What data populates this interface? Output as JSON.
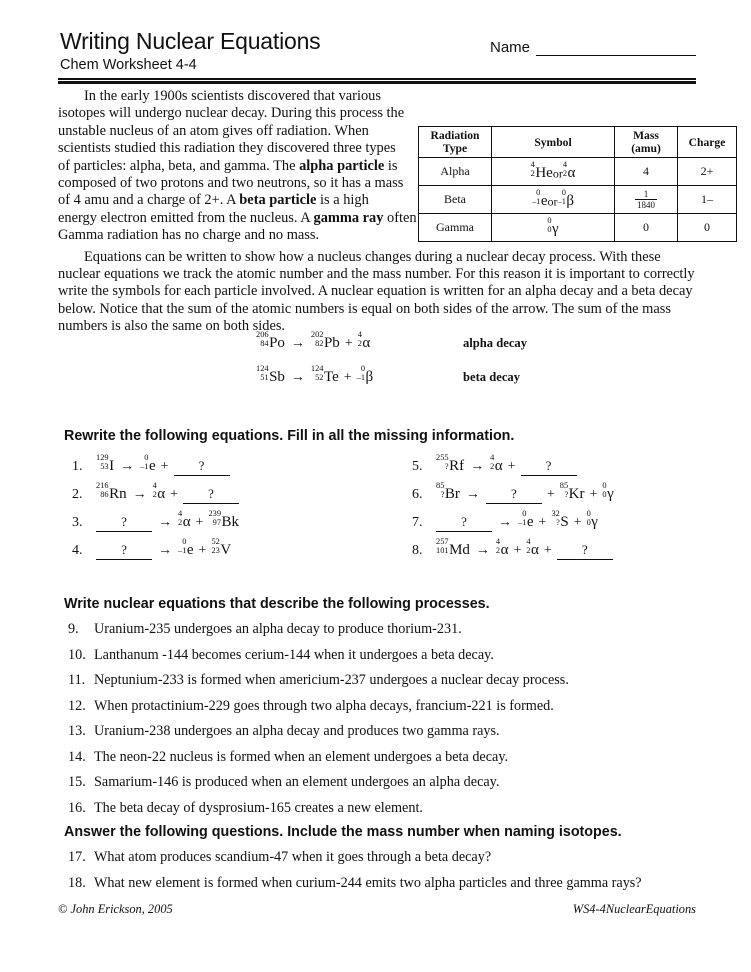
{
  "header": {
    "title": "Writing Nuclear Equations",
    "subtitle": "Chem Worksheet 4-4",
    "name_label": "Name"
  },
  "intro": {
    "p1_part1": "In the early 1900s scientists discovered that various isotopes will undergo nuclear decay. During this process the unstable nucleus of an atom gives off radiation. When scientists studied this radiation they discovered three types of particles: alpha, beta, and gamma. The ",
    "p1_b1": "alpha particle",
    "p1_part2": " is composed of two protons and two neutrons, so it has a mass of 4 amu and a charge of 2+. A ",
    "p1_b2": "beta particle",
    "p1_part3": " is a high energy electron emitted from the nucleus. A ",
    "p1_b3": "gamma ray",
    "p1_part4": " often accompanies the other decay processes. Gamma radiation has no charge and no mass.",
    "p2": "Equations can be written to show how a nucleus changes during a nuclear decay process. With these nuclear equations we track the atomic number and the mass number. For this reason it is important to correctly write the symbols for each particle involved. A nuclear equation is written for an alpha decay and a beta decay below. Notice that the sum of the atomic numbers is equal on both sides of the arrow. The sum of the mass numbers is also the same on both sides."
  },
  "radiation_table": {
    "headers": [
      "Radiation Type",
      "Symbol",
      "Mass (amu)",
      "Charge"
    ],
    "header_lines": {
      "type_l1": "Radiation",
      "type_l2": "Type",
      "symbol": "Symbol",
      "mass_l1": "Mass",
      "mass_l2": "(amu)",
      "charge": "Charge"
    },
    "rows": [
      {
        "type": "Alpha",
        "symbol_1": {
          "mass": "4",
          "atomic": "2",
          "element": "He"
        },
        "symbol_or": "or",
        "symbol_2": {
          "mass": "4",
          "atomic": "2",
          "element": "α"
        },
        "mass": "4",
        "charge": "2+"
      },
      {
        "type": "Beta",
        "symbol_1": {
          "mass": "0",
          "atomic": "–1",
          "element": "e"
        },
        "symbol_or": "or",
        "symbol_2": {
          "mass": "0",
          "atomic": "–1",
          "element": "β"
        },
        "mass_num": "1",
        "mass_den": "1840",
        "charge": "1–"
      },
      {
        "type": "Gamma",
        "symbol_1": {
          "mass": "0",
          "atomic": "0",
          "element": "γ"
        },
        "mass": "0",
        "charge": "0"
      }
    ]
  },
  "examples": [
    {
      "left": {
        "mass": "206",
        "atomic": "84",
        "element": "Po"
      },
      "arrow": "→",
      "right1": {
        "mass": "202",
        "atomic": "82",
        "element": "Pb"
      },
      "plus": "+",
      "right2": {
        "mass": "4",
        "atomic": "2",
        "element": "α"
      },
      "label": "alpha decay"
    },
    {
      "left": {
        "mass": "124",
        "atomic": "51",
        "element": "Sb"
      },
      "arrow": "→",
      "right1": {
        "mass": "124",
        "atomic": "52",
        "element": "Te"
      },
      "plus": "+",
      "right2": {
        "mass": "0",
        "atomic": "–1",
        "element": "β"
      },
      "label": "beta decay"
    }
  ],
  "fill_section": {
    "heading": "Rewrite the following equations. Fill in all the missing information.",
    "blank_mark": "?",
    "problems": [
      {
        "num": "1.",
        "parts": [
          {
            "kind": "nuc",
            "mass": "129",
            "atomic": "53",
            "element": "I"
          },
          {
            "kind": "op",
            "text": "→"
          },
          {
            "kind": "nuc",
            "mass": "0",
            "atomic": "–1",
            "element": "e"
          },
          {
            "kind": "op",
            "text": "+"
          },
          {
            "kind": "blank",
            "text": "?"
          }
        ]
      },
      {
        "num": "2.",
        "parts": [
          {
            "kind": "nuc",
            "mass": "216",
            "atomic": "86",
            "element": "Rn"
          },
          {
            "kind": "op",
            "text": "→"
          },
          {
            "kind": "nuc",
            "mass": "4",
            "atomic": "2",
            "element": "α"
          },
          {
            "kind": "op",
            "text": "+"
          },
          {
            "kind": "blank",
            "text": "?"
          }
        ]
      },
      {
        "num": "3.",
        "parts": [
          {
            "kind": "blank",
            "text": "?"
          },
          {
            "kind": "op",
            "text": "→"
          },
          {
            "kind": "nuc",
            "mass": "4",
            "atomic": "2",
            "element": "α"
          },
          {
            "kind": "op",
            "text": "+"
          },
          {
            "kind": "nuc",
            "mass": "239",
            "atomic": "97",
            "element": "Bk"
          }
        ]
      },
      {
        "num": "4.",
        "parts": [
          {
            "kind": "blank",
            "text": "?"
          },
          {
            "kind": "op",
            "text": "→"
          },
          {
            "kind": "nuc",
            "mass": "0",
            "atomic": "–1",
            "element": "e"
          },
          {
            "kind": "op",
            "text": "+"
          },
          {
            "kind": "nuc",
            "mass": "52",
            "atomic": "23",
            "element": "V"
          }
        ]
      },
      {
        "num": "5.",
        "parts": [
          {
            "kind": "nuc",
            "mass": "255",
            "atomic": "?",
            "element": "Rf"
          },
          {
            "kind": "op",
            "text": "→"
          },
          {
            "kind": "nuc",
            "mass": "4",
            "atomic": "2",
            "element": "α"
          },
          {
            "kind": "op",
            "text": "+"
          },
          {
            "kind": "blank",
            "text": "?"
          }
        ]
      },
      {
        "num": "6.",
        "parts": [
          {
            "kind": "nuc",
            "mass": "85",
            "atomic": "?",
            "element": "Br"
          },
          {
            "kind": "op",
            "text": "→"
          },
          {
            "kind": "blank",
            "text": "?"
          },
          {
            "kind": "op",
            "text": "+"
          },
          {
            "kind": "nuc",
            "mass": "85",
            "atomic": "?",
            "element": "Kr"
          },
          {
            "kind": "op",
            "text": "+"
          },
          {
            "kind": "nuc",
            "mass": "0",
            "atomic": "0",
            "element": "γ"
          }
        ]
      },
      {
        "num": "7.",
        "parts": [
          {
            "kind": "blank",
            "text": "?"
          },
          {
            "kind": "op",
            "text": "→"
          },
          {
            "kind": "nuc",
            "mass": "0",
            "atomic": "–1",
            "element": "e"
          },
          {
            "kind": "op",
            "text": "+"
          },
          {
            "kind": "nuc",
            "mass": "32",
            "atomic": "?",
            "element": "S"
          },
          {
            "kind": "op",
            "text": "+"
          },
          {
            "kind": "nuc",
            "mass": "0",
            "atomic": "0",
            "element": "γ"
          }
        ]
      },
      {
        "num": "8.",
        "parts": [
          {
            "kind": "nuc",
            "mass": "257",
            "atomic": "101",
            "element": "Md"
          },
          {
            "kind": "op",
            "text": "→"
          },
          {
            "kind": "nuc",
            "mass": "4",
            "atomic": "2",
            "element": "α"
          },
          {
            "kind": "op",
            "text": "+"
          },
          {
            "kind": "nuc",
            "mass": "4",
            "atomic": "2",
            "element": "α"
          },
          {
            "kind": "op",
            "text": "+"
          },
          {
            "kind": "blank",
            "text": "?"
          }
        ]
      }
    ]
  },
  "processes_section": {
    "heading": "Write nuclear equations that describe the following processes.",
    "items": [
      {
        "num": "9.",
        "text": "Uranium-235 undergoes an alpha decay to produce thorium-231."
      },
      {
        "num": "10.",
        "text": "Lanthanum -144 becomes cerium-144 when it undergoes a beta decay."
      },
      {
        "num": "11.",
        "text": "Neptunium-233 is formed when americium-237 undergoes a nuclear decay process."
      },
      {
        "num": "12.",
        "text": "When protactinium-229 goes through two alpha decays, francium-221 is formed."
      },
      {
        "num": "13.",
        "text": "Uranium-238 undergoes an alpha decay and produces two gamma rays."
      },
      {
        "num": "14.",
        "text": "The neon-22 nucleus is formed when an element undergoes a beta decay."
      },
      {
        "num": "15.",
        "text": "Samarium-146 is produced when an element undergoes an alpha decay."
      },
      {
        "num": "16.",
        "text": "The beta decay of dysprosium-165 creates a new element."
      }
    ]
  },
  "answer_section": {
    "heading": "Answer the following questions. Include the mass number when naming isotopes.",
    "items": [
      {
        "num": "17.",
        "text": "What atom produces scandium-47 when it goes through a beta decay?"
      },
      {
        "num": "18.",
        "text": "What new element is formed when curium-244 emits two alpha particles and three gamma rays?"
      }
    ]
  },
  "footer": {
    "copyright": "© John Erickson, 2005",
    "docid": "WS4-4NuclearEquations"
  }
}
